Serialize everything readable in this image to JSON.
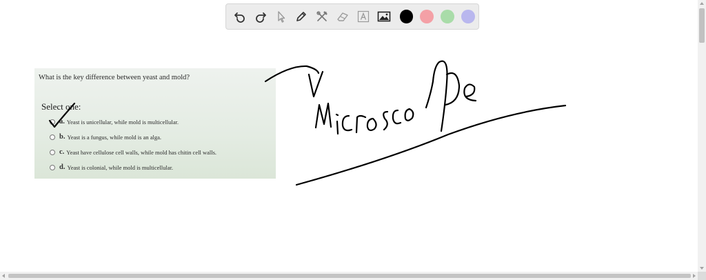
{
  "toolbar": {
    "tools": [
      "undo-icon",
      "redo-icon",
      "pointer-icon",
      "pen-icon",
      "tools-icon",
      "eraser-icon",
      "text-icon",
      "image-icon"
    ],
    "colors": [
      "#000000",
      "#f4a0a6",
      "#a9dca9",
      "#b9b7ee"
    ],
    "selected_color": "#000000"
  },
  "question": {
    "title": "What is the key difference between yeast and mold?",
    "prompt": "Select one:",
    "options": [
      {
        "letter": "a.",
        "text": "Yeast is unicellular, while mold is multicellular."
      },
      {
        "letter": "b.",
        "text": "Yeast is a fungus, while mold is an alga."
      },
      {
        "letter": "c.",
        "text": "Yeast have cellulose cell walls, while mold has chitin cell walls."
      },
      {
        "letter": "d.",
        "text": "Yeast is colonial, while mold is multicellular."
      }
    ]
  },
  "annotation": {
    "handwritten_word": "Microscope",
    "ink_color": "#000000"
  }
}
